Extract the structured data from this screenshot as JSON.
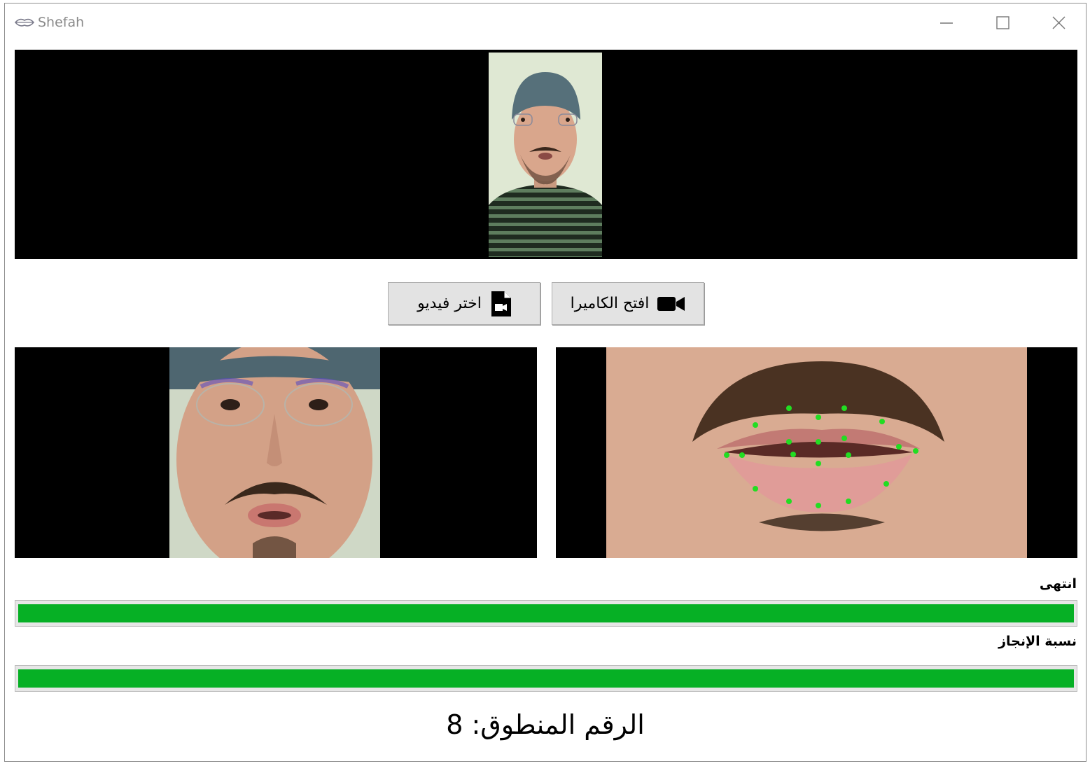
{
  "window": {
    "title": "Shefah",
    "icon": "lips-icon",
    "controls": [
      "minimize-icon",
      "maximize-icon",
      "close-icon"
    ]
  },
  "buttons": {
    "choose_video": {
      "label": "اختر فيديو",
      "icon": "file-video-icon"
    },
    "open_camera": {
      "label": "افتح الكاميرا",
      "icon": "video-camera-icon"
    }
  },
  "progress": {
    "status_label": "انتهى",
    "status_value": 1.0,
    "completion_label": "نسبة الإنجاز",
    "completion_value": 1.0,
    "fill_color": "#06b025"
  },
  "result": {
    "label": "الرقم المنطوق:",
    "value": "8"
  }
}
